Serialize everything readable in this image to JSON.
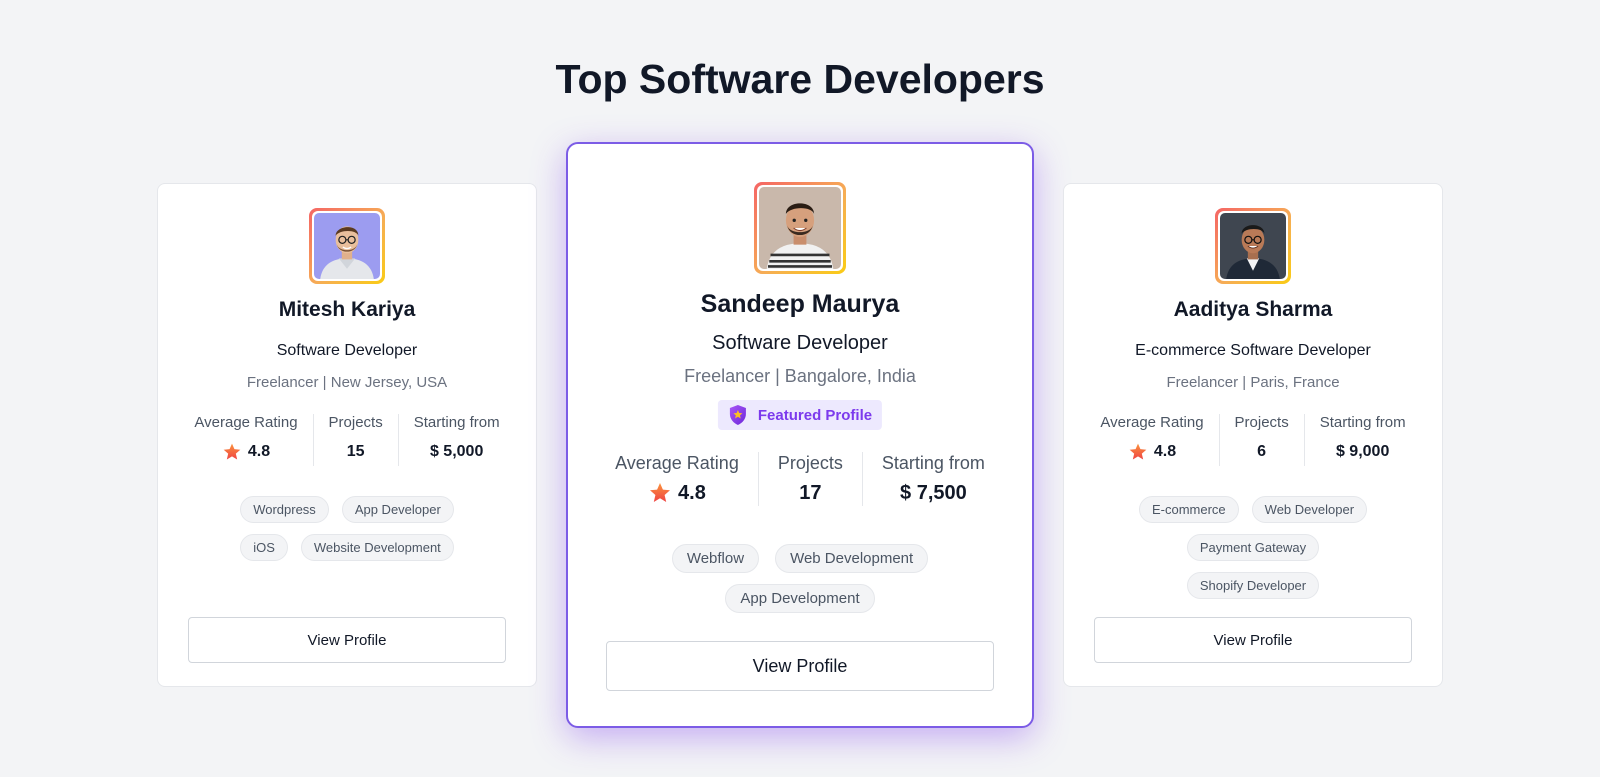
{
  "page": {
    "title": "Top Software Developers"
  },
  "colors": {
    "accent": "#7c3aed",
    "featured_border": "#7c5ce6",
    "star": "#f97316",
    "badge_bg": "#ede9fe"
  },
  "cards": [
    {
      "name": "Mitesh Kariya",
      "role": "Software Developer",
      "location": "Freelancer | New Jersey, USA",
      "avatar_icon": "avatar-photo",
      "stats": [
        {
          "label": "Average Rating",
          "value": "4.8",
          "icon": "star-icon"
        },
        {
          "label": "Projects",
          "value": "15"
        },
        {
          "label": "Starting from",
          "value": "$ 5,000"
        }
      ],
      "tags": [
        "Wordpress",
        "App Developer",
        "iOS",
        "Website Development"
      ],
      "button_label": "View Profile"
    },
    {
      "name": "Sandeep Maurya",
      "role": "Software Developer",
      "location": "Freelancer | Bangalore, India",
      "avatar_icon": "avatar-photo",
      "badge": "Featured Profile",
      "stats": [
        {
          "label": "Average Rating",
          "value": "4.8",
          "icon": "star-icon"
        },
        {
          "label": "Projects",
          "value": "17"
        },
        {
          "label": "Starting from",
          "value": "$ 7,500"
        }
      ],
      "tags": [
        "Webflow",
        "Web Development",
        "App Development"
      ],
      "button_label": "View Profile"
    },
    {
      "name": "Aaditya Sharma",
      "role": "E-commerce Software Developer",
      "location": "Freelancer | Paris, France",
      "avatar_icon": "avatar-photo",
      "stats": [
        {
          "label": "Average Rating",
          "value": "4.8",
          "icon": "star-icon"
        },
        {
          "label": "Projects",
          "value": "6"
        },
        {
          "label": "Starting from",
          "value": "$ 9,000"
        }
      ],
      "tags": [
        "E-commerce",
        "Web Developer",
        "Payment Gateway",
        "Shopify Developer"
      ],
      "button_label": "View Profile"
    }
  ]
}
